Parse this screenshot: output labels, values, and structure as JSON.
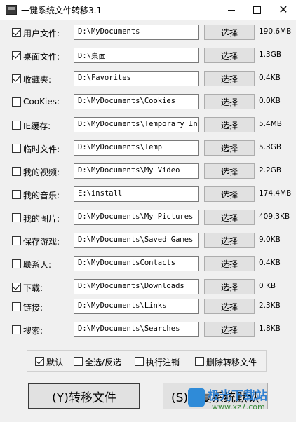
{
  "window": {
    "title": "一键系统文件转移3.1",
    "minimize_icon": "minimize-icon",
    "maximize_icon": "maximize-icon",
    "close_icon": "close-icon"
  },
  "rows": [
    {
      "label": "用户文件:",
      "checked": true,
      "path": "D:\\MyDocuments",
      "button": "选择",
      "size": "190.6MB"
    },
    {
      "label": "桌面文件:",
      "checked": true,
      "path": "D:\\桌面",
      "button": "选择",
      "size": "1.3GB"
    },
    {
      "label": "收藏夹:",
      "checked": true,
      "path": "D:\\Favorites",
      "button": "选择",
      "size": "0.4KB"
    },
    {
      "label": "CooKies:",
      "checked": false,
      "path": "D:\\MyDocuments\\Cookies",
      "button": "选择",
      "size": "0.0KB"
    },
    {
      "label": "IE缓存:",
      "checked": false,
      "path": "D:\\MyDocuments\\Temporary Inte",
      "button": "选择",
      "size": "5.4MB"
    },
    {
      "label": "临时文件:",
      "checked": false,
      "path": "D:\\MyDocuments\\Temp",
      "button": "选择",
      "size": "5.3GB"
    },
    {
      "label": "我的视频:",
      "checked": false,
      "path": "D:\\MyDocuments\\My Video",
      "button": "选择",
      "size": "2.2GB"
    },
    {
      "label": "我的音乐:",
      "checked": false,
      "path": "E:\\install",
      "button": "选择",
      "size": "174.4MB"
    },
    {
      "label": "我的图片:",
      "checked": false,
      "path": "D:\\MyDocuments\\My Pictures",
      "button": "选择",
      "size": "409.3KB"
    },
    {
      "label": "保存游戏:",
      "checked": false,
      "path": "D:\\MyDocuments\\Saved Games",
      "button": "选择",
      "size": "9.0KB"
    },
    {
      "label": "联系人:",
      "checked": false,
      "path": "D:\\MyDocumentsContacts",
      "button": "选择",
      "size": "0.4KB"
    },
    {
      "label": "下载:",
      "checked": true,
      "path": "D:\\MyDocuments\\Downloads",
      "button": "选择",
      "size": "0 KB"
    },
    {
      "label": "链接:",
      "checked": false,
      "path": "D:\\MyDocuments\\Links",
      "button": "选择",
      "size": "2.3KB"
    },
    {
      "label": "搜索:",
      "checked": false,
      "path": "D:\\MyDocuments\\Searches",
      "button": "选择",
      "size": "1.8KB"
    }
  ],
  "options": [
    {
      "label": "默认",
      "checked": true
    },
    {
      "label": "全选/反选",
      "checked": false
    },
    {
      "label": "执行注销",
      "checked": false
    },
    {
      "label": "删除转移文件",
      "checked": false
    }
  ],
  "actions": {
    "transfer_label": "(Y)转移文件",
    "restore_label": "(S)恢复系统默认"
  },
  "watermark": {
    "brand": "极光下载站",
    "url": "www.xz7.com"
  }
}
